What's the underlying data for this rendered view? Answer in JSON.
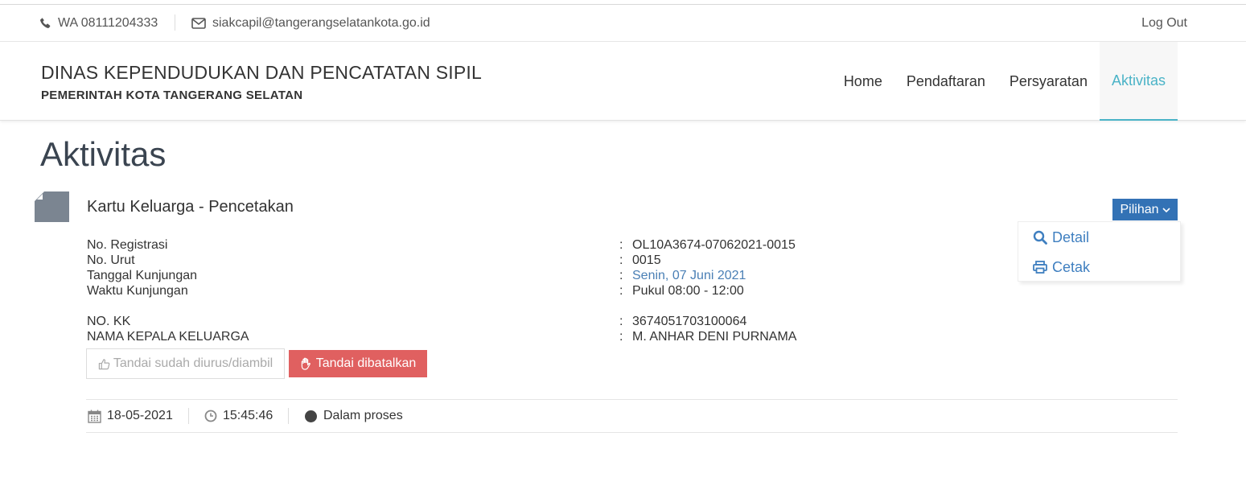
{
  "topbar": {
    "phone": "WA 08111204333",
    "email": "siakcapil@tangerangselatankota.go.id",
    "logout": "Log Out"
  },
  "header": {
    "title": "DINAS KEPENDUDUKAN DAN PENCATATAN SIPIL",
    "subtitle": "PEMERINTAH KOTA TANGERANG SELATAN"
  },
  "nav": {
    "items": [
      {
        "label": "Home"
      },
      {
        "label": "Pendaftaran"
      },
      {
        "label": "Persyaratan"
      },
      {
        "label": "Aktivitas"
      }
    ],
    "active": "Aktivitas"
  },
  "page": {
    "title": "Aktivitas"
  },
  "item": {
    "title": "Kartu Keluarga - Pencetakan",
    "options_button": "Pilihan",
    "options": [
      {
        "label": "Detail",
        "icon": "search-icon"
      },
      {
        "label": "Cetak",
        "icon": "print-icon"
      }
    ],
    "fields": [
      {
        "label": "No. Registrasi",
        "value": "OL10A3674-07062021-0015"
      },
      {
        "label": "No. Urut",
        "value": "0015"
      },
      {
        "label": "Tanggal Kunjungan",
        "value": "Senin, 07 Juni 2021"
      },
      {
        "label": "Waktu Kunjungan",
        "value": "Pukul 08:00 - 12:00"
      },
      {
        "label": "NO. KK",
        "value": "3674051703100064"
      },
      {
        "label": "NAMA KEPALA KELUARGA",
        "value": "M. ANHAR DENI PURNAMA"
      }
    ],
    "colon": ":",
    "mark_done_button": "Tandai sudah diurus/diambil",
    "mark_cancel_button": "Tandai dibatalkan",
    "date": "18-05-2021",
    "time": "15:45:46",
    "status": "Dalam proses"
  },
  "colors": {
    "accent": "#4ab3c7",
    "primary_button": "#3372b5",
    "danger_button": "#e06060",
    "link": "#4a7fb5"
  }
}
